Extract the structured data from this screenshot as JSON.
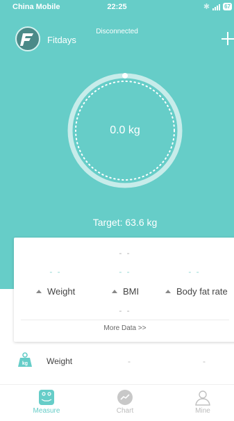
{
  "status_bar": {
    "carrier": "China Mobile",
    "time": "22:25",
    "battery": "67"
  },
  "header": {
    "app_name": "Fitdays",
    "connection_status": "Disconnected"
  },
  "dial": {
    "weight": "0.0 kg"
  },
  "target": "Target: 63.6 kg",
  "card": {
    "top_placeholder": "- -",
    "weight_value": "- -",
    "bmi_value": "- -",
    "bodyfat_value": "- -",
    "weight_label": "Weight",
    "bmi_label": "BMI",
    "bodyfat_label": "Body fat rate",
    "bottom_placeholder": "- -",
    "more_label": "More Data >>"
  },
  "weight_row": {
    "label": "Weight",
    "value1": "-",
    "value2": "-"
  },
  "tabs": [
    {
      "label": "Measure",
      "active": true
    },
    {
      "label": "Chart",
      "active": false
    },
    {
      "label": "Mine",
      "active": false
    }
  ],
  "colors": {
    "accent": "#66cdc8",
    "inactive": "#bbbbbb"
  }
}
